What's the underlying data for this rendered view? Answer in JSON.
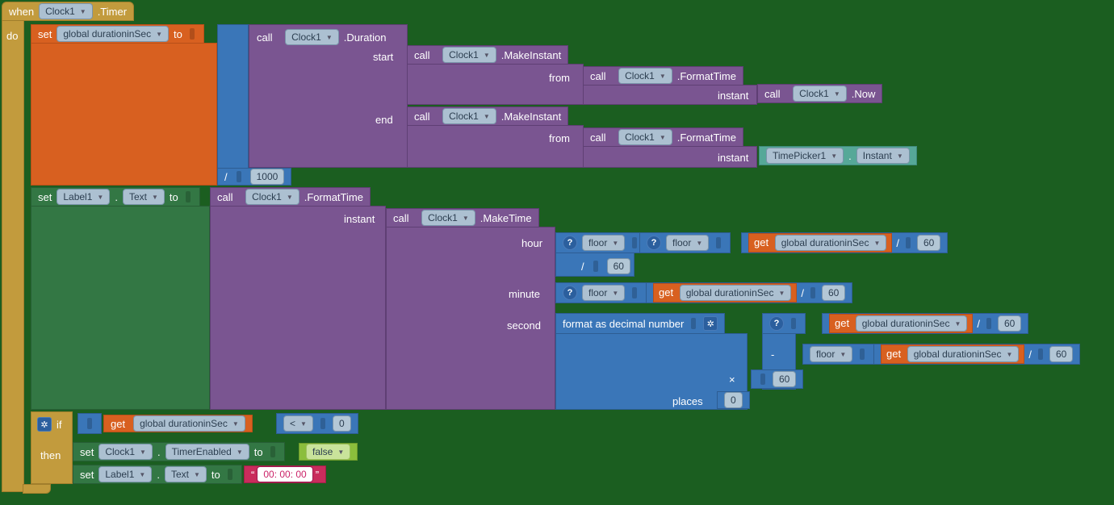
{
  "when": "when",
  "do": "do",
  "clock1": "Clock1",
  "timer": ".Timer",
  "set": "set",
  "global_duration": "global durationinSec",
  "to": "to",
  "call": "call",
  "duration": ".Duration",
  "start": "start",
  "end": "end",
  "make_instant": ".MakeInstant",
  "from": "from",
  "format_time": ".FormatTime",
  "instant": "instant",
  "now": ".Now",
  "timepicker1": "TimePicker1",
  "instant_prop": "Instant",
  "div": "/",
  "n1000": "1000",
  "label1": "Label1",
  "text_prop": "Text",
  "make_time": ".MakeTime",
  "hour": "hour",
  "minute": "minute",
  "second": "second",
  "floor": "floor",
  "get": "get",
  "n60": "60",
  "format_dec": "format as decimal number",
  "minus": "-",
  "mult": "×",
  "places": "places",
  "n0": "0",
  "if": "if",
  "lt": "<",
  "then": "then",
  "timer_enabled": "TimerEnabled",
  "false": "false",
  "zero_time": " 00: 00: 00 ",
  "qopen": "“",
  "qclose": "”",
  "dot": "."
}
